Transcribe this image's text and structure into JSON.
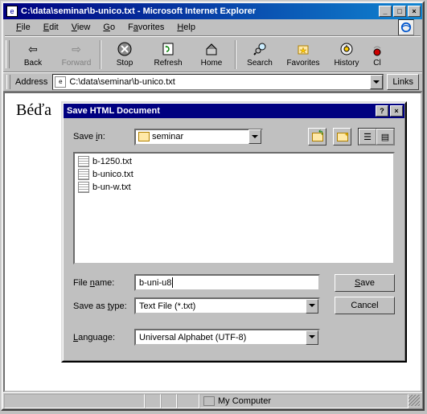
{
  "window": {
    "title": "C:\\data\\seminar\\b-unico.txt - Microsoft Internet Explorer"
  },
  "menu": {
    "file": "File",
    "edit": "Edit",
    "view": "View",
    "go": "Go",
    "favorites": "Favorites",
    "help": "Help"
  },
  "toolbar": {
    "back": "Back",
    "forward": "Forward",
    "stop": "Stop",
    "refresh": "Refresh",
    "home": "Home",
    "search": "Search",
    "favorites": "Favorites",
    "history": "History",
    "channels": "Cl"
  },
  "address": {
    "label": "Address",
    "value": "C:\\data\\seminar\\b-unico.txt",
    "links": "Links"
  },
  "document": {
    "text": "Béďa"
  },
  "dialog": {
    "title": "Save HTML Document",
    "savein_label": "Save in:",
    "savein_value": "seminar",
    "files": [
      {
        "name": "b-1250.txt"
      },
      {
        "name": "b-unico.txt"
      },
      {
        "name": "b-un-w.txt"
      }
    ],
    "filename_label": "File name:",
    "filename_value": "b-uni-u8",
    "saveastype_label": "Save as type:",
    "saveastype_value": "Text File (*.txt)",
    "language_label": "Language:",
    "language_value": "Universal Alphabet (UTF-8)",
    "save_btn": "Save",
    "cancel_btn": "Cancel"
  },
  "status": {
    "text": "My Computer"
  }
}
